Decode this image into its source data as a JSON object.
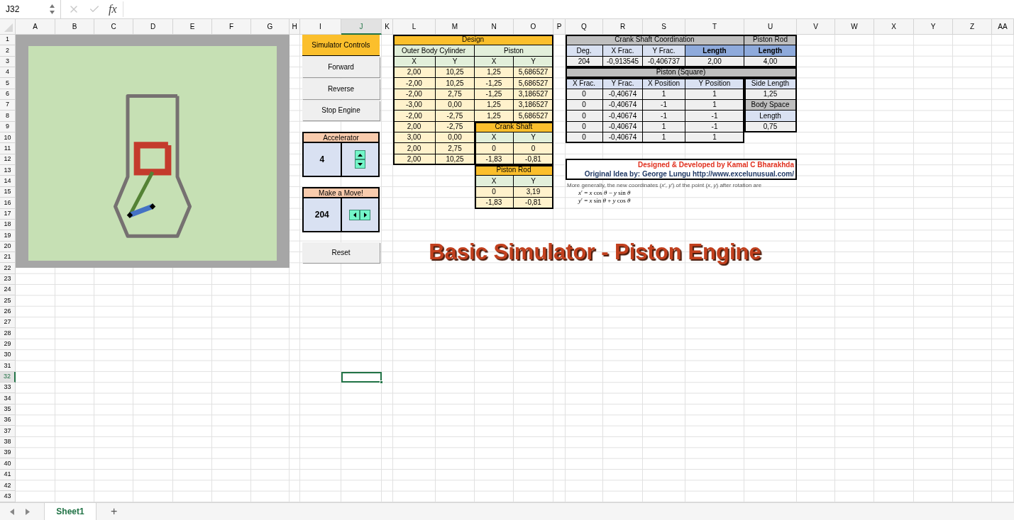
{
  "formula_bar": {
    "name_box": "J32",
    "function_label": "fx"
  },
  "columns": [
    {
      "label": "A",
      "selected": false
    },
    {
      "label": "B",
      "selected": false
    },
    {
      "label": "C",
      "selected": false
    },
    {
      "label": "D",
      "selected": false
    },
    {
      "label": "E",
      "selected": false
    },
    {
      "label": "F",
      "selected": false
    },
    {
      "label": "G",
      "selected": false
    },
    {
      "label": "H",
      "selected": false
    },
    {
      "label": "I",
      "selected": false
    },
    {
      "label": "J",
      "selected": true
    },
    {
      "label": "K",
      "selected": false
    },
    {
      "label": "L",
      "selected": false
    },
    {
      "label": "M",
      "selected": false
    },
    {
      "label": "N",
      "selected": false
    },
    {
      "label": "O",
      "selected": false
    },
    {
      "label": "P",
      "selected": false
    },
    {
      "label": "Q",
      "selected": false
    },
    {
      "label": "R",
      "selected": false
    },
    {
      "label": "S",
      "selected": false
    },
    {
      "label": "T",
      "selected": false
    },
    {
      "label": "U",
      "selected": false
    },
    {
      "label": "V",
      "selected": false
    },
    {
      "label": "W",
      "selected": false
    },
    {
      "label": "X",
      "selected": false
    },
    {
      "label": "Y",
      "selected": false
    },
    {
      "label": "Z",
      "selected": false
    },
    {
      "label": "AA",
      "selected": false
    }
  ],
  "rows": [
    {
      "label": "1",
      "selected": false
    },
    {
      "label": "2",
      "selected": false
    },
    {
      "label": "3",
      "selected": false
    },
    {
      "label": "4",
      "selected": false
    },
    {
      "label": "5",
      "selected": false
    },
    {
      "label": "6",
      "selected": false
    },
    {
      "label": "7",
      "selected": false
    },
    {
      "label": "8",
      "selected": false
    },
    {
      "label": "9",
      "selected": false
    },
    {
      "label": "10",
      "selected": false
    },
    {
      "label": "11",
      "selected": false
    },
    {
      "label": "12",
      "selected": false
    },
    {
      "label": "13",
      "selected": false
    },
    {
      "label": "14",
      "selected": false
    },
    {
      "label": "15",
      "selected": false
    },
    {
      "label": "16",
      "selected": false
    },
    {
      "label": "17",
      "selected": false
    },
    {
      "label": "18",
      "selected": false
    },
    {
      "label": "19",
      "selected": false
    },
    {
      "label": "20",
      "selected": false
    },
    {
      "label": "21",
      "selected": false
    },
    {
      "label": "22",
      "selected": false
    },
    {
      "label": "23",
      "selected": false
    },
    {
      "label": "24",
      "selected": false
    },
    {
      "label": "25",
      "selected": false
    },
    {
      "label": "26",
      "selected": false
    },
    {
      "label": "27",
      "selected": false
    },
    {
      "label": "28",
      "selected": false
    },
    {
      "label": "29",
      "selected": false
    },
    {
      "label": "30",
      "selected": false
    },
    {
      "label": "31",
      "selected": false
    },
    {
      "label": "32",
      "selected": true
    },
    {
      "label": "33",
      "selected": false
    },
    {
      "label": "34",
      "selected": false
    },
    {
      "label": "35",
      "selected": false
    },
    {
      "label": "36",
      "selected": false
    },
    {
      "label": "37",
      "selected": false
    },
    {
      "label": "38",
      "selected": false
    },
    {
      "label": "39",
      "selected": false
    },
    {
      "label": "40",
      "selected": false
    },
    {
      "label": "41",
      "selected": false
    },
    {
      "label": "42",
      "selected": false
    },
    {
      "label": "43",
      "selected": false
    }
  ],
  "controls": {
    "title": "Simulator Controls",
    "buttons": [
      "Forward",
      "Reverse",
      "Stop Engine"
    ],
    "accelerator": {
      "label": "Accelerator",
      "value": "4"
    },
    "move": {
      "label": "Make a Move!",
      "value": "204"
    },
    "reset": "Reset"
  },
  "design": {
    "title": "Design",
    "outer_body": {
      "title": "Outer Body Cylinder",
      "columns": [
        "X",
        "Y"
      ],
      "rows": [
        [
          "2,00",
          "10,25"
        ],
        [
          "-2,00",
          "10,25"
        ],
        [
          "-2,00",
          "2,75"
        ],
        [
          "-3,00",
          "0,00"
        ],
        [
          "-2,00",
          "-2,75"
        ],
        [
          "2,00",
          "-2,75"
        ],
        [
          "3,00",
          "0,00"
        ],
        [
          "2,00",
          "2,75"
        ],
        [
          "2,00",
          "10,25"
        ]
      ]
    },
    "piston": {
      "title": "Piston",
      "columns": [
        "X",
        "Y"
      ],
      "rows": [
        [
          "1,25",
          "5,686527"
        ],
        [
          "-1,25",
          "5,686527"
        ],
        [
          "-1,25",
          "3,186527"
        ],
        [
          "1,25",
          "3,186527"
        ],
        [
          "1,25",
          "5,686527"
        ]
      ]
    },
    "crank_shaft": {
      "title": "Crank Shaft",
      "columns": [
        "X",
        "Y"
      ],
      "rows": [
        [
          "0",
          "0"
        ],
        [
          "-1,83",
          "-0,81"
        ]
      ]
    },
    "piston_rod": {
      "title": "Piston Rod",
      "columns": [
        "X",
        "Y"
      ],
      "rows": [
        [
          "0",
          "3,19"
        ],
        [
          "-1,83",
          "-0,81"
        ]
      ]
    }
  },
  "crank_coordination": {
    "title": "Crank Shaft Coordination",
    "columns": [
      "Deg.",
      "X Frac.",
      "Y Frac.",
      "Length"
    ],
    "values": [
      "204",
      "-0,913545",
      "-0,406737",
      "2,00"
    ]
  },
  "piston_rod_length": {
    "title": "Piston Rod",
    "column": "Length",
    "value": "4,00"
  },
  "piston_square": {
    "title": "Piston (Square)",
    "columns": [
      "X Frac.",
      "Y Frac.",
      "X Position",
      "Y Position"
    ],
    "rows": [
      [
        "0",
        "-0,40674",
        "1",
        "1"
      ],
      [
        "0",
        "-0,40674",
        "-1",
        "1"
      ],
      [
        "0",
        "-0,40674",
        "-1",
        "-1"
      ],
      [
        "0",
        "-0,40674",
        "1",
        "-1"
      ],
      [
        "0",
        "-0,40674",
        "1",
        "1"
      ]
    ]
  },
  "side_length": {
    "column": "Side Length",
    "value": "1,25"
  },
  "body_space": {
    "title": "Body Space",
    "column": "Length",
    "value": "0,75"
  },
  "credits": {
    "designer": "Designed & Developed by Kamal C Bharakhda",
    "idea": "Original Idea by: George Lungu http://www.excelunusual.com/"
  },
  "formula_note": {
    "text": "More generally, the new coordinates (*x*′, *y*′) of the point (*x*, *y*) after rotation are",
    "lines": [
      "*x*′ = *x* cos *θ* − *y* sin *θ*",
      "*y*′ = *x* sin *θ* + *y* cos *θ*"
    ]
  },
  "title": "Basic Simulator - Piston Engine",
  "sheet_tabs": [
    {
      "label": "Sheet1",
      "selected": true
    }
  ],
  "add_sheet": "+"
}
